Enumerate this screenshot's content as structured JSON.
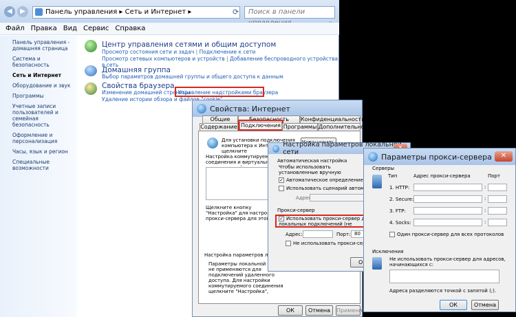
{
  "explorer": {
    "breadcrumb": [
      "Панель управления",
      "Сеть и Интернет"
    ],
    "search_placeholder": "Поиск в панели управления",
    "menu": [
      "Файл",
      "Правка",
      "Вид",
      "Сервис",
      "Справка"
    ],
    "sidebar": [
      "Панель управления - домашняя страница",
      "Система и безопасность",
      "Сеть и Интернет",
      "Оборудование и звук",
      "Программы",
      "Учетные записи пользователей и семейная безопасность",
      "Оформление и персонализация",
      "Часы, язык и регион",
      "Специальные возможности"
    ],
    "sections": [
      {
        "title": "Центр управления сетями и общим доступом",
        "links": [
          "Просмотр состояния сети и задач",
          "Подключение к сети",
          "Просмотр сетевых компьютеров и устройств",
          "Добавление беспроводного устройства в сеть"
        ]
      },
      {
        "title": "Домашняя группа",
        "links": [
          "Выбор параметров домашней группы и общего доступа к данным"
        ]
      },
      {
        "title": "Свойства браузера",
        "links": [
          "Изменение домашней страницы",
          "Управление надстройками браузера",
          "Удаление истории обзора и файлов \"cookie\""
        ]
      }
    ]
  },
  "inet": {
    "title": "Свойства: Интернет",
    "tabs_top": [
      "Общие",
      "Безопасность",
      "Конфиденциальность"
    ],
    "tabs_bottom": [
      "Содержание",
      "Подключения",
      "Программы",
      "Дополнительно"
    ],
    "setup_text": "Для установки подключения компьютера к Интернету щелкните",
    "setup_btn": "Установить",
    "dialup_label": "Настройка коммутируемого соединения и виртуальных частных сетей",
    "hint": "Щелкните кнопку \"Настройка\" для настройки прокси-сервера для этого подключения.",
    "lan_label": "Настройка параметров локальной сети",
    "lan_text": "Параметры локальной сети не применяются для подключений удаленного доступа. Для настройки коммутируемого соединения щелкните \"Настройка\", расположенную выше.",
    "ok": "ОК",
    "cancel": "Отмена",
    "apply": "Применить"
  },
  "lan": {
    "title": "Настройка параметров локальной сети",
    "auto_label": "Автоматическая настройка",
    "auto_text": "Чтобы использовать установленные вручную параметры, отключите автоматическую настройку.",
    "auto_detect": "Автоматическое определение параметров",
    "script": "Использовать сценарий автоматической настройки",
    "addr_label": "Адрес",
    "proxy_label": "Прокси-сервер",
    "use_proxy": "Использовать прокси-сервер для локальных подключений (не применяется для коммутируемых или VPN-подключений).",
    "addr": "Адрес:",
    "port": "Порт:",
    "port_val": "80",
    "bypass": "Не использовать прокси-сервер для локальных адресов",
    "ok": "ОК"
  },
  "proxy": {
    "title": "Параметры прокси-сервера",
    "servers": "Серверы",
    "col_type": "Тип",
    "col_addr": "Адрес прокси-сервера",
    "col_port": "Порт",
    "rows": [
      "1. HTTP:",
      "2. Secure:",
      "3. FTP:",
      "4. Socks:"
    ],
    "same": "Один прокси-сервер для всех протоколов",
    "exceptions": "Исключения",
    "exc_text": "Не использовать прокси-сервер для адресов, начинающихся с:",
    "exc_hint": "Адреса разделяются точкой с запятой (;).",
    "ok": "ОК",
    "cancel": "Отмена"
  }
}
